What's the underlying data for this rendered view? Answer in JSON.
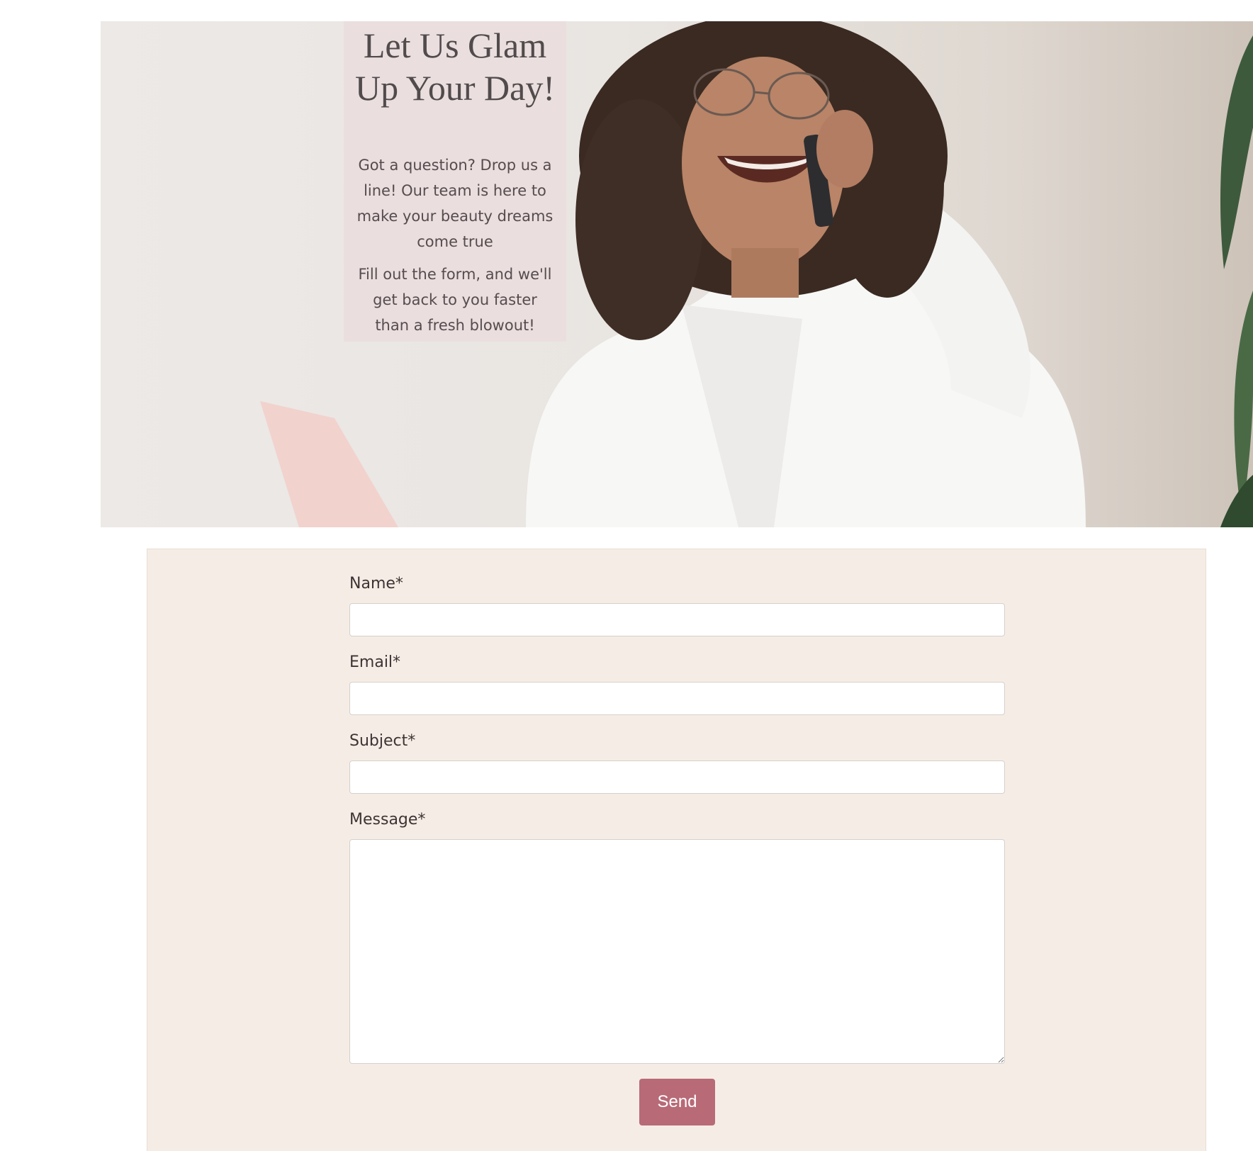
{
  "hero": {
    "title": "Let Us Glam Up Your Day!",
    "paragraph_1": "Got a question? Drop us a line! Our team is here to make your beauty dreams come true",
    "paragraph_2": "Fill out the form, and we'll get back to you faster than a fresh blowout!",
    "image": "woman-on-phone-photo"
  },
  "form": {
    "fields": [
      {
        "label": "Name*",
        "value": "",
        "type": "text"
      },
      {
        "label": "Email*",
        "value": "",
        "type": "email"
      },
      {
        "label": "Subject*",
        "value": "",
        "type": "text"
      },
      {
        "label": "Message*",
        "value": "",
        "type": "textarea"
      }
    ],
    "submit_label": "Send"
  },
  "colors": {
    "form_background": "#f5ede5",
    "button": "#b86a77",
    "hero_text_panel": "#eadcdd"
  }
}
